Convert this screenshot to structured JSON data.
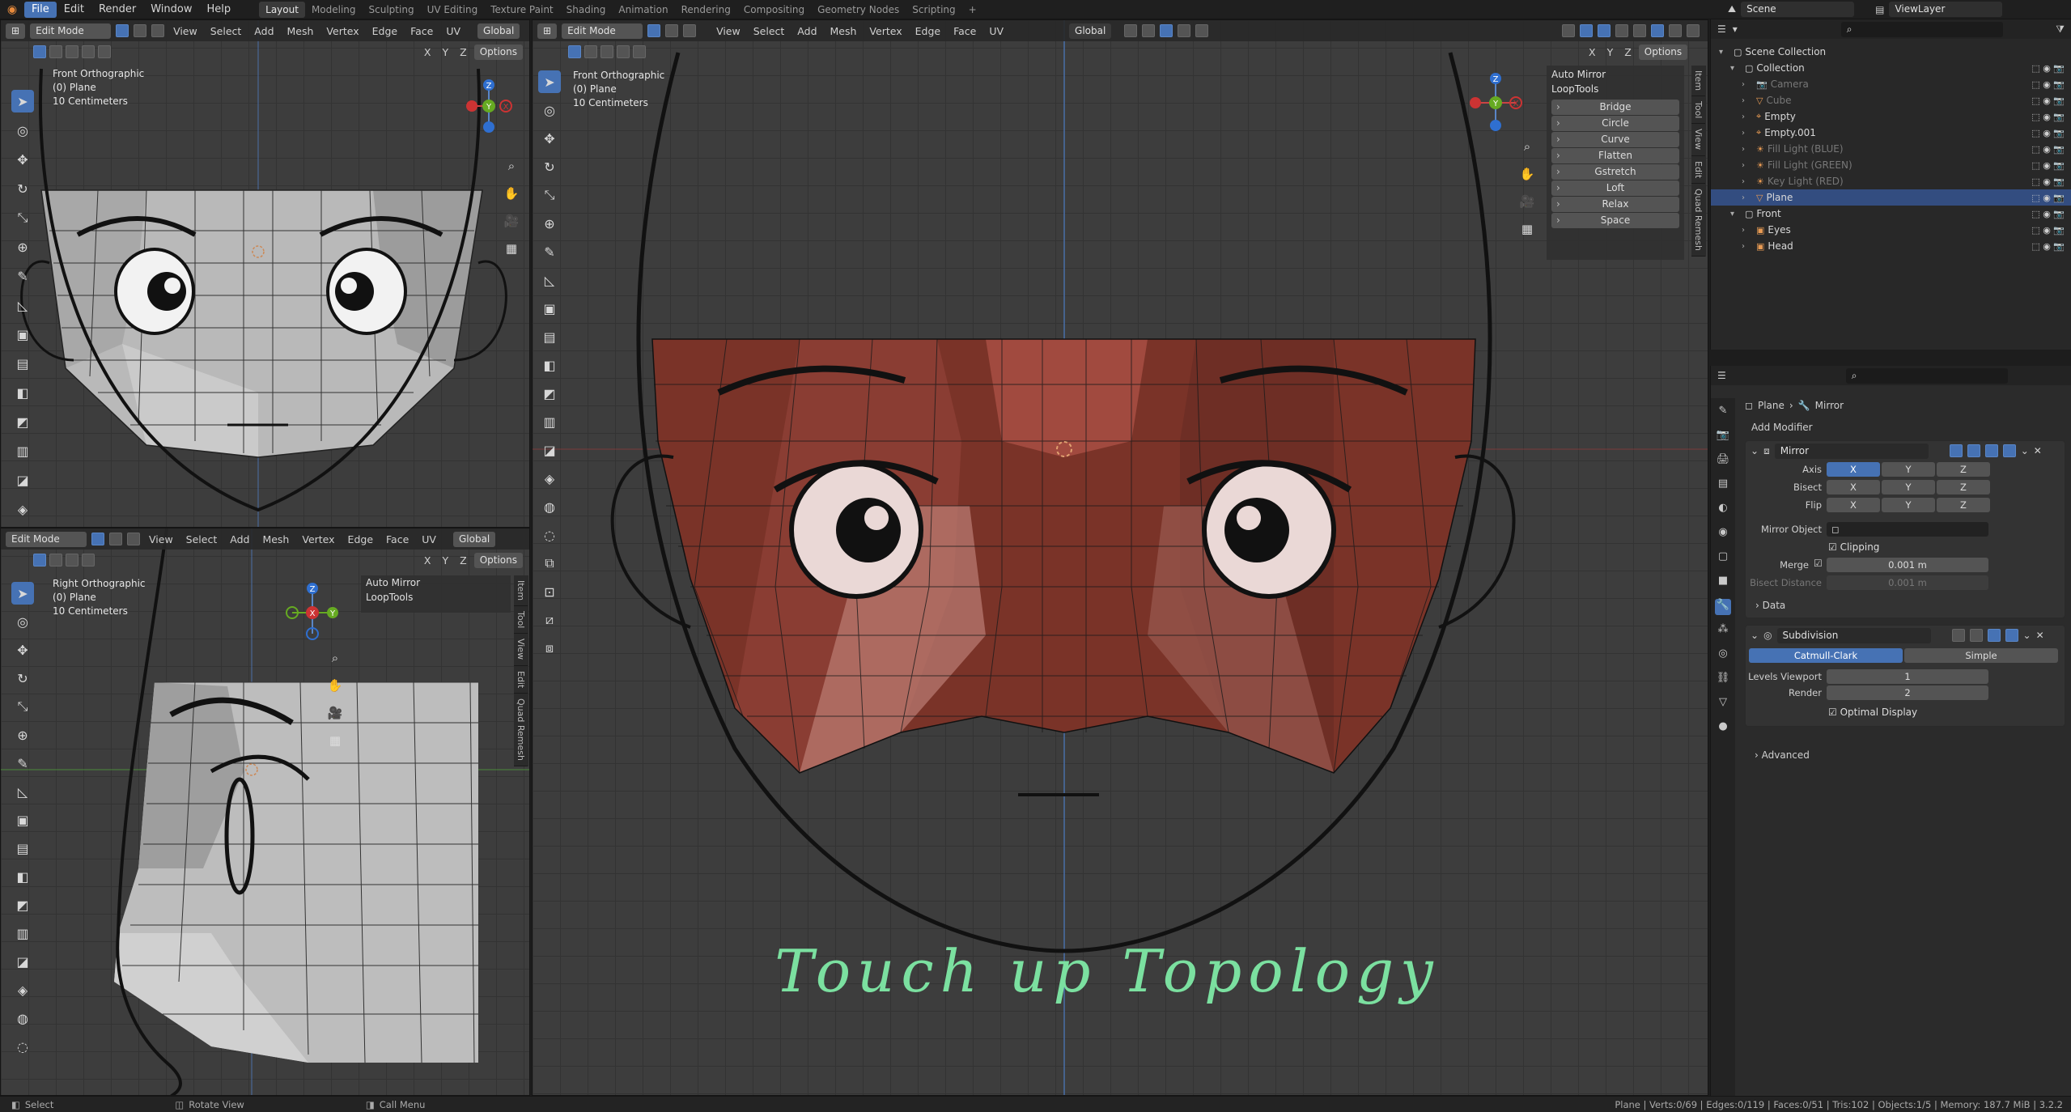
{
  "topbar": {
    "menus": [
      "File",
      "Edit",
      "Render",
      "Window",
      "Help"
    ],
    "workspaces": [
      "Layout",
      "Modeling",
      "Sculpting",
      "UV Editing",
      "Texture Paint",
      "Shading",
      "Animation",
      "Rendering",
      "Compositing",
      "Geometry Nodes",
      "Scripting"
    ],
    "add_tab": "+",
    "scene": "Scene",
    "view_layer": "ViewLayer"
  },
  "viewport_header": {
    "mode": "Edit Mode",
    "menus": [
      "View",
      "Select",
      "Add",
      "Mesh",
      "Vertex",
      "Edge",
      "Face",
      "UV"
    ],
    "orientation": "Global",
    "axes": [
      "X",
      "Y",
      "Z"
    ],
    "options": "Options"
  },
  "vp_front": {
    "title": "Front Orthographic",
    "object": "(0) Plane",
    "scale": "10 Centimeters"
  },
  "vp_right": {
    "title": "Right Orthographic",
    "object": "(0) Plane",
    "scale": "10 Centimeters"
  },
  "vp_main": {
    "title": "Front Orthographic",
    "object": "(0) Plane",
    "scale": "10 Centimeters",
    "annotation": "Touch up Topology"
  },
  "gizmo": {
    "x": "X",
    "y": "Y",
    "z": "Z"
  },
  "side_tabs": [
    "Item",
    "Tool",
    "View",
    "Edit",
    "Quad Remesh"
  ],
  "npanel": {
    "auto_mirror": "Auto Mirror",
    "looptools": "LoopTools",
    "buttons": [
      "Bridge",
      "Circle",
      "Curve",
      "Flatten",
      "Gstretch",
      "Loft",
      "Relax",
      "Space"
    ]
  },
  "outliner": {
    "search_placeholder": "",
    "rows": [
      {
        "name": "Scene Collection",
        "depth": 0,
        "icon": "collection-icon",
        "dim": false,
        "sel": false
      },
      {
        "name": "Collection",
        "depth": 1,
        "icon": "collection-icon",
        "dim": false,
        "sel": false
      },
      {
        "name": "Camera",
        "depth": 2,
        "icon": "camera-icon",
        "dim": true,
        "sel": false
      },
      {
        "name": "Cube",
        "depth": 2,
        "icon": "mesh-icon",
        "dim": true,
        "sel": false
      },
      {
        "name": "Empty",
        "depth": 2,
        "icon": "empty-icon",
        "dim": false,
        "sel": false
      },
      {
        "name": "Empty.001",
        "depth": 2,
        "icon": "empty-icon",
        "dim": false,
        "sel": false
      },
      {
        "name": "Fill Light (BLUE)",
        "depth": 2,
        "icon": "light-icon",
        "dim": true,
        "sel": false
      },
      {
        "name": "Fill Light (GREEN)",
        "depth": 2,
        "icon": "light-icon",
        "dim": true,
        "sel": false
      },
      {
        "name": "Key Light (RED)",
        "depth": 2,
        "icon": "light-icon",
        "dim": true,
        "sel": false
      },
      {
        "name": "Plane",
        "depth": 2,
        "icon": "mesh-icon",
        "dim": false,
        "sel": true
      },
      {
        "name": "Front",
        "depth": 1,
        "icon": "collection-icon",
        "dim": false,
        "sel": false
      },
      {
        "name": "Eyes",
        "depth": 2,
        "icon": "image-icon",
        "dim": false,
        "sel": false
      },
      {
        "name": "Head",
        "depth": 2,
        "icon": "image-icon",
        "dim": false,
        "sel": false
      }
    ]
  },
  "properties": {
    "breadcrumb_obj": "Plane",
    "breadcrumb_mod": "Mirror",
    "add_modifier": "Add Modifier",
    "mirror": {
      "name": "Mirror",
      "axis_label": "Axis",
      "bisect_label": "Bisect",
      "flip_label": "Flip",
      "x": "X",
      "y": "Y",
      "z": "Z",
      "mirror_object_label": "Mirror Object",
      "clipping": "Clipping",
      "merge_label": "Merge",
      "merge_value": "0.001 m",
      "bisect_distance_label": "Bisect Distance",
      "bisect_distance_value": "0.001 m",
      "data": "Data"
    },
    "subdivision": {
      "name": "Subdivision",
      "catmull": "Catmull-Clark",
      "simple": "Simple",
      "levels_label": "Levels Viewport",
      "levels_value": "1",
      "render_label": "Render",
      "render_value": "2",
      "optimal": "Optimal Display",
      "advanced": "Advanced"
    }
  },
  "status": {
    "select": "Select",
    "rotate": "Rotate View",
    "call_menu": "Call Menu",
    "stats": "Plane | Verts:0/69 | Edges:0/119 | Faces:0/51 | Tris:102 | Objects:1/5 | Memory: 187.7 MiB | 3.2.2"
  },
  "colors": {
    "accent": "#4672b4",
    "face_red": "#7a3328",
    "annotation": "#7be0a0"
  }
}
